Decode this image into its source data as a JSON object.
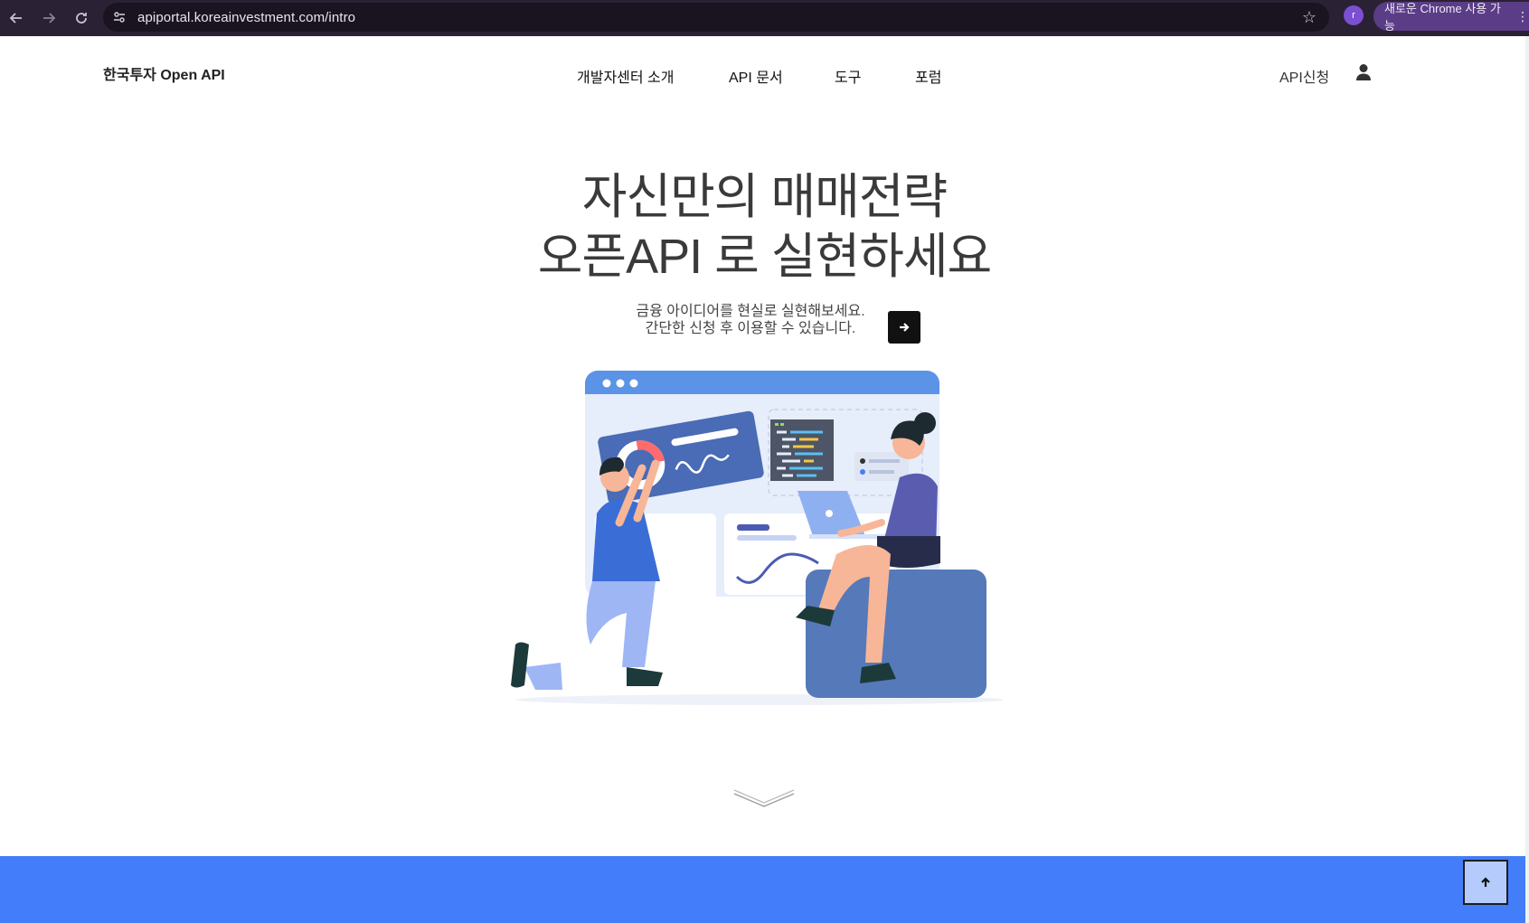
{
  "browser": {
    "url": "apiportal.koreainvestment.com/intro",
    "profile_initial": "r",
    "chrome_notice": "새로운 Chrome 사용 가능",
    "icons": [
      "back-arrow-icon",
      "forward-arrow-icon",
      "reload-icon",
      "site-info-icon",
      "star-icon",
      "kebab-menu-icon"
    ]
  },
  "header": {
    "logo": "한국투자 Open API",
    "nav": [
      {
        "label": "개발자센터 소개"
      },
      {
        "label": "API 문서"
      },
      {
        "label": "도구"
      },
      {
        "label": "포럼"
      }
    ],
    "apply_label": "API신청",
    "user_icon": "user-icon"
  },
  "hero": {
    "title_line1": "자신만의 매매전략",
    "title_line2": "오픈API 로 실현하세요",
    "subtitle_line1": "금융 아이디어를 현실로 실현해보세요.",
    "subtitle_line2": "간단한 신청 후 이용할 수 있습니다.",
    "go_icon": "arrow-right-icon"
  },
  "footer_band": {
    "color": "#437df9",
    "to_top_icon": "arrow-up-icon"
  },
  "colors": {
    "chrome_bg": "#2b2134",
    "accent_blue": "#437df9",
    "button_dark": "#111111"
  }
}
